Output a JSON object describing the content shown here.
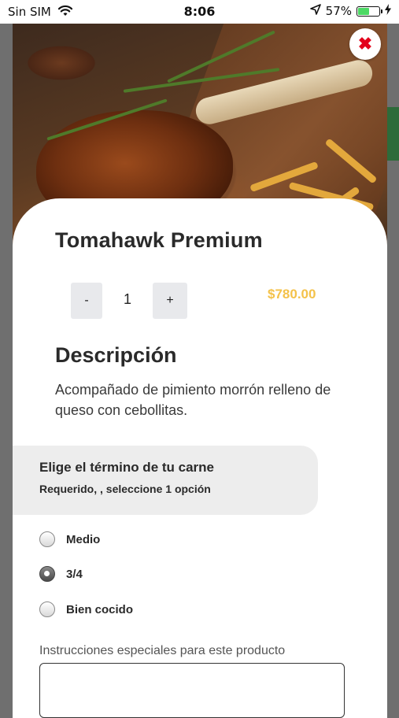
{
  "status_bar": {
    "carrier": "Sin SIM",
    "time": "8:06",
    "battery": "57%",
    "battery_level": 0.57
  },
  "product": {
    "name": "Tomahawk Premium",
    "quantity": "1",
    "decrement_label": "-",
    "increment_label": "+",
    "price": "$780.00",
    "description_heading": "Descripción",
    "description": "Acompañado de pimiento morrón relleno de queso con cebollitas."
  },
  "options": {
    "title": "Elige el término de tu carne",
    "subtitle": "Requerido, , seleccione 1 opción",
    "items": [
      {
        "label": "Medio",
        "selected": false
      },
      {
        "label": "3/4",
        "selected": true
      },
      {
        "label": "Bien cocido",
        "selected": false
      }
    ]
  },
  "instructions": {
    "label": "Instrucciones especiales para este producto",
    "value": ""
  },
  "colors": {
    "price": "#f4c24a",
    "close_icon": "#e3001b",
    "battery": "#4cd964"
  },
  "icons": {
    "close": "close-icon",
    "wifi": "wifi-icon",
    "location": "location-arrow-icon",
    "charging": "charging-bolt-icon"
  }
}
